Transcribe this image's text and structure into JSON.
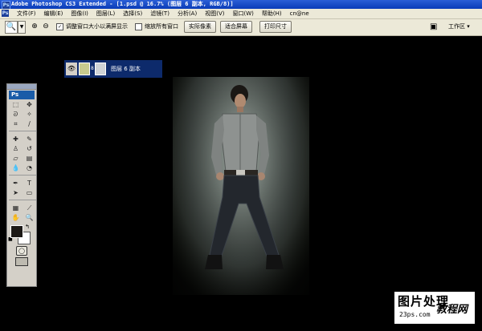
{
  "window": {
    "title": "Adobe Photoshop CS3 Extended - [1.psd @ 16.7% (图层 6 副本, RGB/8)]",
    "app_icon": "Ps"
  },
  "menubar": {
    "items": [
      "文件(F)",
      "编辑(E)",
      "图像(I)",
      "图层(L)",
      "选择(S)",
      "滤镜(T)",
      "分析(A)",
      "视图(V)",
      "窗口(W)",
      "帮助(H)",
      "cn@ne"
    ]
  },
  "options_bar": {
    "tool_icon": "zoom-icon",
    "zoom_in_icon": "⊕",
    "zoom_out_icon": "⊖",
    "resize_windows_label": "调整窗口大小以满屏显示",
    "resize_windows_checked": true,
    "zoom_all_label": "缩放所有窗口",
    "zoom_all_checked": false,
    "actual_pixels": "实际像素",
    "fit_screen": "适合屏幕",
    "print_size": "打印尺寸",
    "workspace": "工作区 ▾"
  },
  "layer_bar": {
    "layer_name": "图层 6 副本",
    "visible": true
  },
  "toolbox": {
    "header": "Ps",
    "tools": [
      {
        "name": "marquee-icon",
        "glyph": "⬚"
      },
      {
        "name": "move-icon",
        "glyph": "✥"
      },
      {
        "name": "lasso-icon",
        "glyph": "ᘐ"
      },
      {
        "name": "magic-wand-icon",
        "glyph": "✧"
      },
      {
        "name": "crop-icon",
        "glyph": "⌗"
      },
      {
        "name": "slice-icon",
        "glyph": "∕"
      },
      {
        "name": "healing-brush-icon",
        "glyph": "✚"
      },
      {
        "name": "brush-icon",
        "glyph": "✎"
      },
      {
        "name": "clone-stamp-icon",
        "glyph": "♙"
      },
      {
        "name": "history-brush-icon",
        "glyph": "↺"
      },
      {
        "name": "eraser-icon",
        "glyph": "▱"
      },
      {
        "name": "gradient-icon",
        "glyph": "▤"
      },
      {
        "name": "blur-icon",
        "glyph": "💧"
      },
      {
        "name": "dodge-icon",
        "glyph": "◔"
      },
      {
        "name": "pen-icon",
        "glyph": "✒"
      },
      {
        "name": "type-icon",
        "glyph": "T"
      },
      {
        "name": "path-selection-icon",
        "glyph": "➤"
      },
      {
        "name": "shape-icon",
        "glyph": "▭"
      },
      {
        "name": "notes-icon",
        "glyph": "▦"
      },
      {
        "name": "eyedropper-icon",
        "glyph": "⟋"
      },
      {
        "name": "hand-icon",
        "glyph": "✋"
      },
      {
        "name": "zoom-tool-icon",
        "glyph": "🔍"
      }
    ],
    "foreground_color": "#1d1a17",
    "background_color": "#ffffff"
  },
  "watermark": {
    "line1": "图片处理",
    "line2": "23ps.com",
    "line3": "教程网"
  }
}
